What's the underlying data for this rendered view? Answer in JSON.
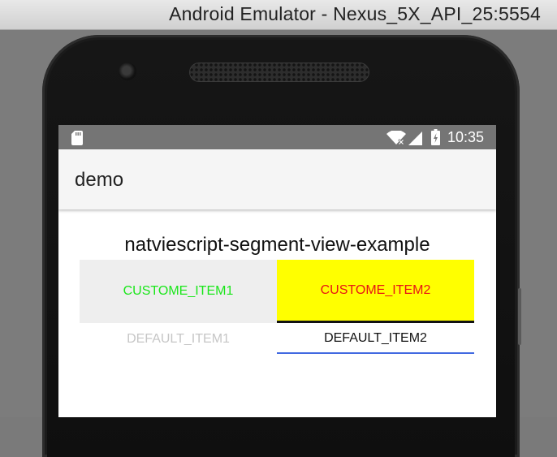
{
  "window": {
    "title": "Android Emulator - Nexus_5X_API_25:5554"
  },
  "status_bar": {
    "time": "10:35",
    "icons": [
      "sd-card-icon",
      "wifi-icon",
      "signal-icon",
      "battery-charging-icon"
    ]
  },
  "app_bar": {
    "title": "demo"
  },
  "content": {
    "heading": "natviescript-segment-view-example",
    "custom_segments": [
      {
        "label": "CUSTOME_ITEM1",
        "text_color": "#19e619",
        "background": "#eeeeee",
        "selected": false
      },
      {
        "label": "CUSTOME_ITEM2",
        "text_color": "#e81515",
        "background": "#ffff00",
        "selected": true,
        "indicator_color": "#111111"
      }
    ],
    "default_segments": [
      {
        "label": "DEFAULT_ITEM1",
        "text_color": "#c6c6c6",
        "selected": false
      },
      {
        "label": "DEFAULT_ITEM2",
        "text_color": "#111111",
        "selected": true,
        "indicator_color": "#4169e1"
      }
    ]
  }
}
